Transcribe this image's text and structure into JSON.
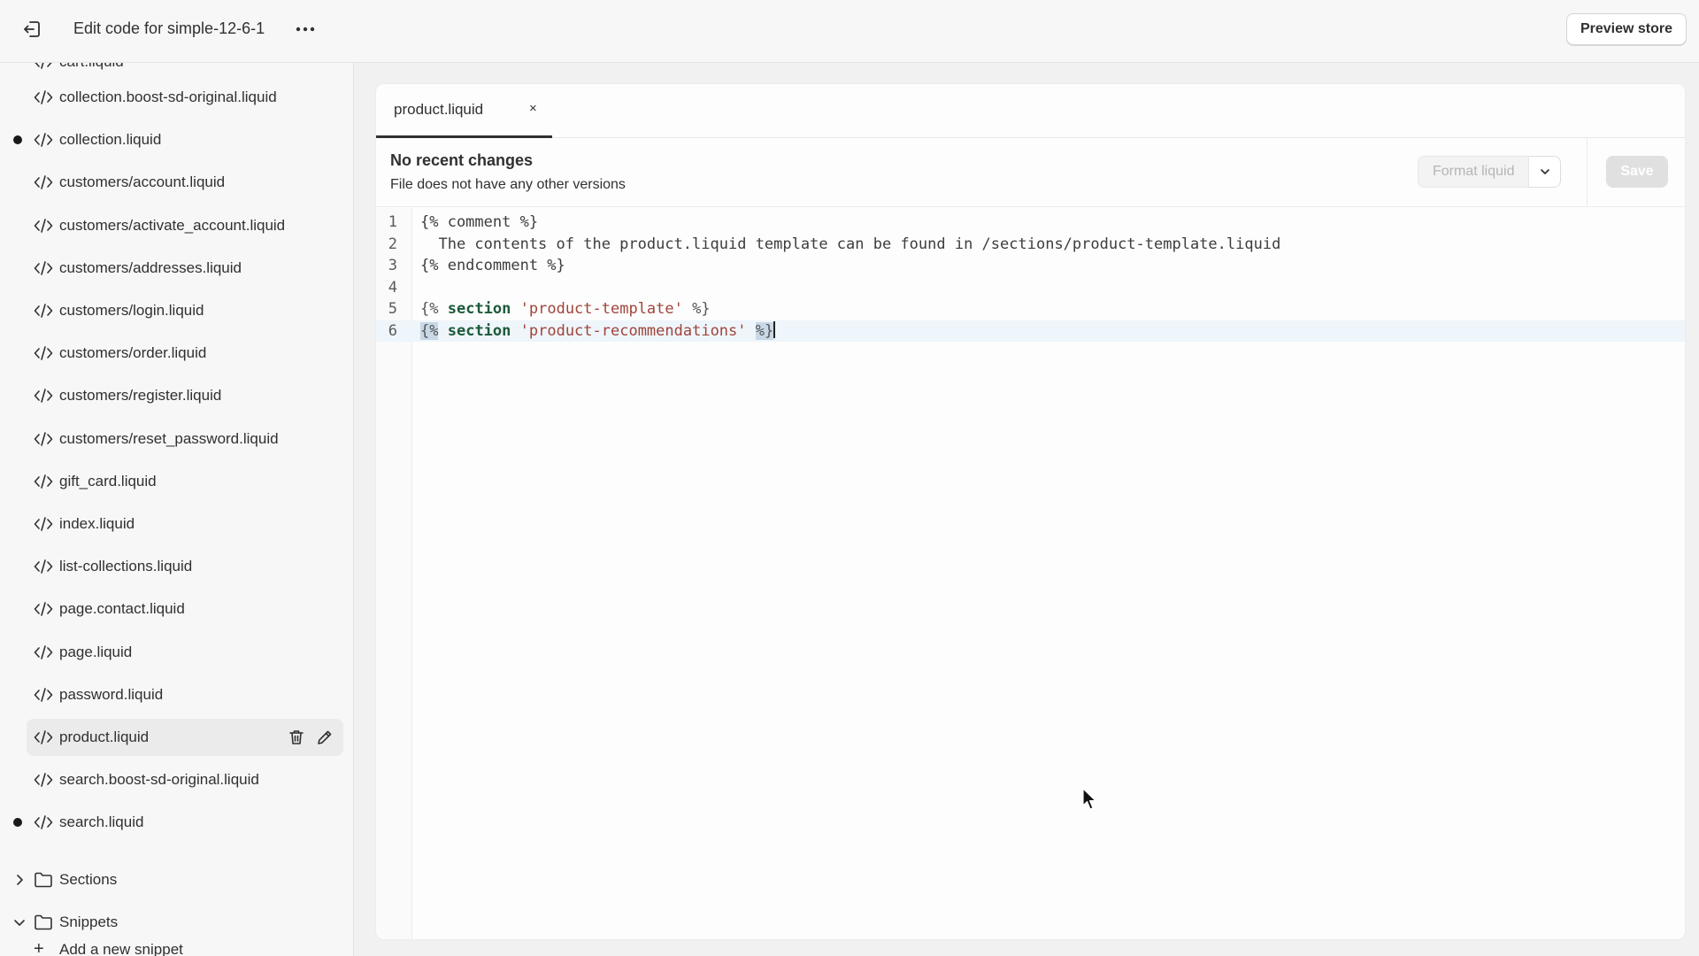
{
  "header": {
    "title": "Edit code for simple-12-6-1",
    "preview_label": "Preview store"
  },
  "sidebar": {
    "partial_top_item": "cart.liquid",
    "files": [
      {
        "label": "collection.boost-sd-original.liquid",
        "dot": false
      },
      {
        "label": "collection.liquid",
        "dot": true
      },
      {
        "label": "customers/account.liquid",
        "dot": false
      },
      {
        "label": "customers/activate_account.liquid",
        "dot": false
      },
      {
        "label": "customers/addresses.liquid",
        "dot": false
      },
      {
        "label": "customers/login.liquid",
        "dot": false
      },
      {
        "label": "customers/order.liquid",
        "dot": false
      },
      {
        "label": "customers/register.liquid",
        "dot": false
      },
      {
        "label": "customers/reset_password.liquid",
        "dot": false
      },
      {
        "label": "gift_card.liquid",
        "dot": false
      },
      {
        "label": "index.liquid",
        "dot": false
      },
      {
        "label": "list-collections.liquid",
        "dot": false
      },
      {
        "label": "page.contact.liquid",
        "dot": false
      },
      {
        "label": "page.liquid",
        "dot": false
      },
      {
        "label": "password.liquid",
        "dot": false
      },
      {
        "label": "product.liquid",
        "dot": false,
        "active": true
      },
      {
        "label": "search.boost-sd-original.liquid",
        "dot": false
      },
      {
        "label": "search.liquid",
        "dot": true
      }
    ],
    "folders": [
      {
        "label": "Sections",
        "expanded": false
      },
      {
        "label": "Snippets",
        "expanded": true
      }
    ],
    "add_snippet_label": "Add a new snippet"
  },
  "editor": {
    "tab_label": "product.liquid",
    "tab_close": "×",
    "status_title": "No recent changes",
    "status_subtitle": "File does not have any other versions",
    "format_label": "Format liquid",
    "save_label": "Save",
    "lines": [
      {
        "n": "1",
        "text": "{% comment %}"
      },
      {
        "n": "2",
        "text": "  The contents of the product.liquid template can be found in /sections/product-template.liquid"
      },
      {
        "n": "3",
        "text": "{% endcomment %}"
      },
      {
        "n": "4",
        "text": ""
      },
      {
        "n": "5",
        "open": "{%",
        "kw": "section",
        "str": "'product-template'",
        "close": "%}"
      },
      {
        "n": "6",
        "open": "{%",
        "kw": "section",
        "str": "'product-recommendations'",
        "close": "%}"
      }
    ]
  },
  "colors": {
    "accent_text": "#303030",
    "keyword": "#1e5a3a",
    "string": "#a0443a",
    "current_line": "#eef5fb"
  }
}
